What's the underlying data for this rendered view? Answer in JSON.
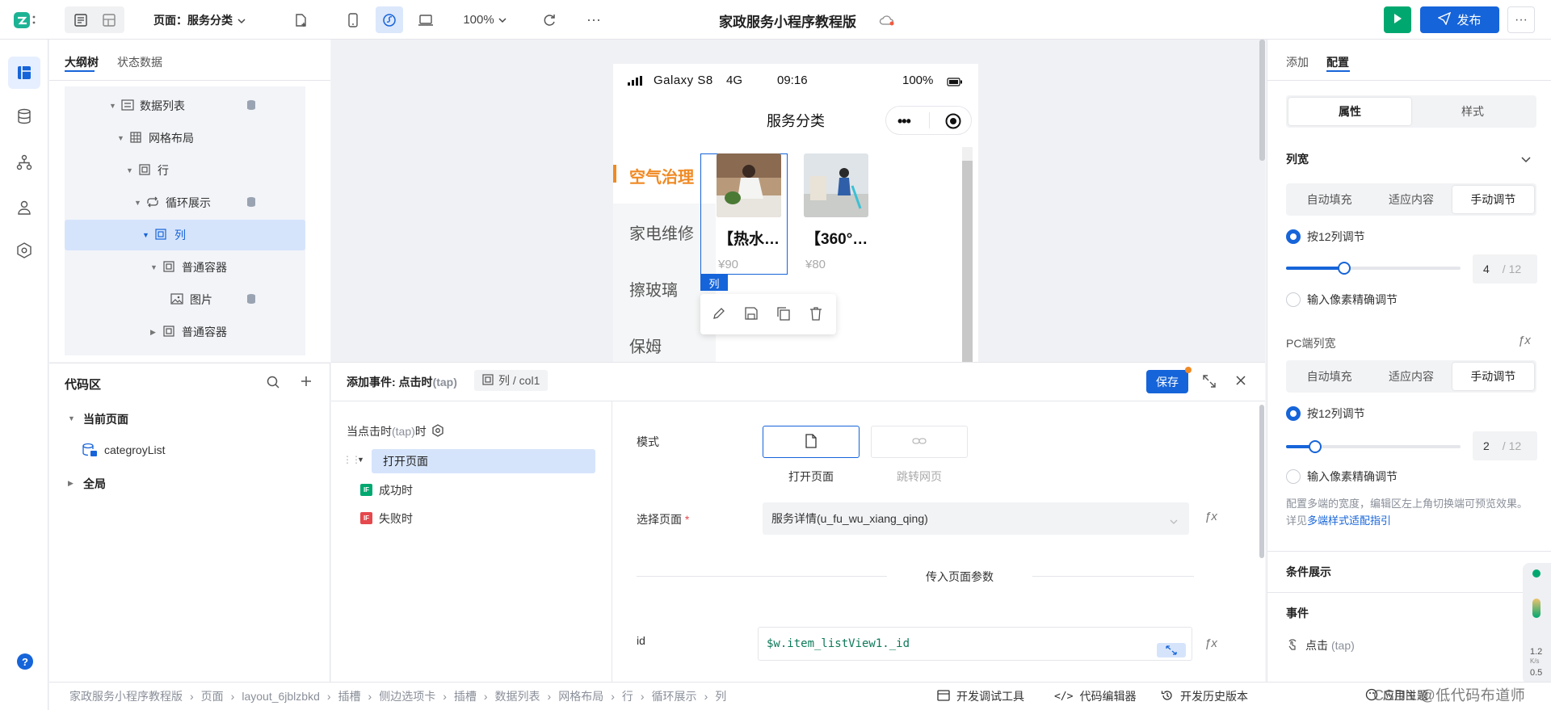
{
  "topbar": {
    "page_label": "页面：服务分类",
    "zoom": "100%",
    "title": "家政服务小程序教程版",
    "publish": "发布"
  },
  "left_tabs": [
    "大纲树",
    "状态数据"
  ],
  "tree": [
    "数据列表",
    "网格布局",
    "行",
    "循环展示",
    "列",
    "普通容器",
    "图片",
    "普通容器"
  ],
  "code": {
    "title": "代码区",
    "current_page": "当前页面",
    "item": "categroyList",
    "global": "全局"
  },
  "phone": {
    "device": "Galaxy S8",
    "network": "4G",
    "time": "09:16",
    "battery": "100%",
    "nav_title": "服务分类",
    "menu": [
      "空气治理",
      "家电维修",
      "擦玻璃",
      "保姆"
    ],
    "cards": [
      {
        "title": "【热水…",
        "price": "¥90"
      },
      {
        "title": "【360°…",
        "price": "¥80"
      }
    ],
    "selected_tag": "列"
  },
  "event": {
    "header": "添加事件: 点击时",
    "header_tap": "(tap)",
    "path": "列 / col1",
    "save": "保存",
    "trigger_label": "当点击时",
    "trigger_tap": "(tap)",
    "trigger_suffix": "时",
    "action": "打开页面",
    "success": "成功时",
    "fail": "失败时",
    "if_badge": "IF",
    "mode_label": "模式",
    "mode_open": "打开页面",
    "mode_jump": "跳转网页",
    "select_label": "选择页面",
    "select_value": "服务详情(u_fu_wu_xiang_qing)",
    "params_title": "传入页面参数",
    "param_key": "id",
    "param_value": "$w.item_listView1._id"
  },
  "right": {
    "tabs": [
      "添加",
      "配置"
    ],
    "sub_tabs": [
      "属性",
      "样式"
    ],
    "col_width": "列宽",
    "modes": [
      "自动填充",
      "适应内容",
      "手动调节"
    ],
    "by12": "按12列调节",
    "pixel": "输入像素精确调节",
    "value1": "4",
    "value2": "2",
    "of12": "/ 12",
    "slider1": 0.333,
    "slider2": 0.167,
    "pc_width": "PC端列宽",
    "help_text": "配置多端的宽度，编辑区左上角切换端可预览效果。详见",
    "help_link": "多端样式适配指引",
    "cond": "条件展示",
    "events": "事件",
    "click": "点击",
    "click_tap": "(tap)",
    "net_speed": "1.2",
    "net_unit": "K/s",
    "net_speed2": "0.5"
  },
  "footer": {
    "crumbs": [
      "家政服务小程序教程版",
      "页面",
      "layout_6jblzbkd",
      "插槽",
      "侧边选项卡",
      "插槽",
      "数据列表",
      "网格布局",
      "行",
      "循环展示",
      "列"
    ],
    "dev_tools": "开发调试工具",
    "code_editor": "代码编辑器",
    "history": "开发历史版本",
    "watermark": "CSDN @低代码布道师",
    "theme": "应用主题"
  },
  "colors": {
    "accent": "#1664d9",
    "green": "#00a870",
    "orange": "#f08a24",
    "red": "#e5484d"
  }
}
